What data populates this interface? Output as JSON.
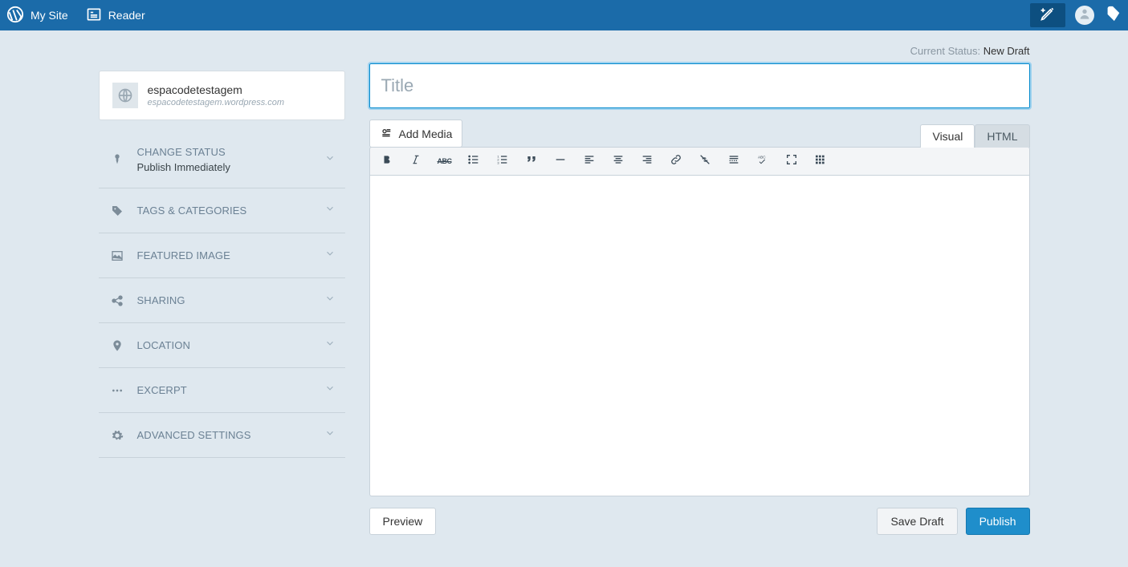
{
  "topbar": {
    "my_site": "My Site",
    "reader": "Reader"
  },
  "site": {
    "name": "espacodetestagem",
    "url": "espacodetestagem.wordpress.com"
  },
  "panels": {
    "status": {
      "label": "CHANGE STATUS",
      "sub": "Publish Immediately"
    },
    "tags": {
      "label": "TAGS & CATEGORIES"
    },
    "image": {
      "label": "FEATURED IMAGE"
    },
    "sharing": {
      "label": "SHARING"
    },
    "location": {
      "label": "LOCATION"
    },
    "excerpt": {
      "label": "EXCERPT"
    },
    "advanced": {
      "label": "ADVANCED SETTINGS"
    }
  },
  "editor": {
    "status_label": "Current Status: ",
    "status_value": "New Draft",
    "title_placeholder": "Title",
    "add_media": "Add Media",
    "tabs": {
      "visual": "Visual",
      "html": "HTML"
    },
    "toolbar_icons": {
      "bold": "bold",
      "italic": "italic",
      "strike": "strike",
      "ul": "bullet-list",
      "ol": "numbered-list",
      "quote": "blockquote",
      "hr": "horizontal-rule",
      "align_l": "align-left",
      "align_c": "align-center",
      "align_r": "align-right",
      "link": "link",
      "unlink": "unlink",
      "more": "insert-more",
      "spell": "spellcheck",
      "fs": "fullscreen",
      "kitchen": "toggle-toolbar"
    }
  },
  "footer": {
    "preview": "Preview",
    "draft": "Save Draft",
    "publish": "Publish"
  }
}
